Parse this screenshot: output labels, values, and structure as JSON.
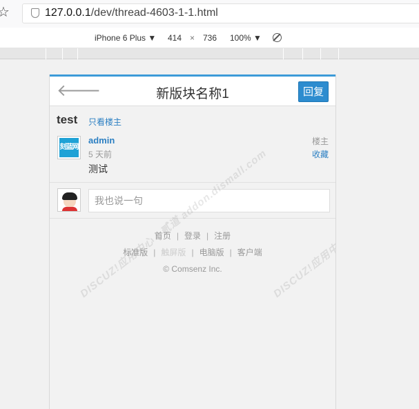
{
  "browser": {
    "url_host": "127.0.0.1",
    "url_path": "/dev/thread-4603-1-1.html"
  },
  "device_toolbar": {
    "device": "iPhone 6 Plus ▼",
    "width": "414",
    "times": "×",
    "height": "736",
    "zoom": "100% ▼"
  },
  "page": {
    "title": "新版块名称1",
    "reply_button": "回复",
    "thread_title": "test",
    "only_author_link": "只看楼主",
    "post": {
      "avatar_text": "刻蓝网",
      "author": "admin",
      "time": "5 天前",
      "content": "测试",
      "floor": "楼主",
      "favorite": "收藏"
    },
    "reply_placeholder": "我也说一句"
  },
  "footer": {
    "home": "首页",
    "login": "登录",
    "register": "注册",
    "standard": "标准版",
    "touch": "触屏版",
    "desktop": "电脑版",
    "client": "客户端",
    "copyright": "© Comsenz Inc.",
    "separator": "|"
  },
  "watermark": "DISCUZ!应用中心 | 贰道 addon.dismall.com"
}
